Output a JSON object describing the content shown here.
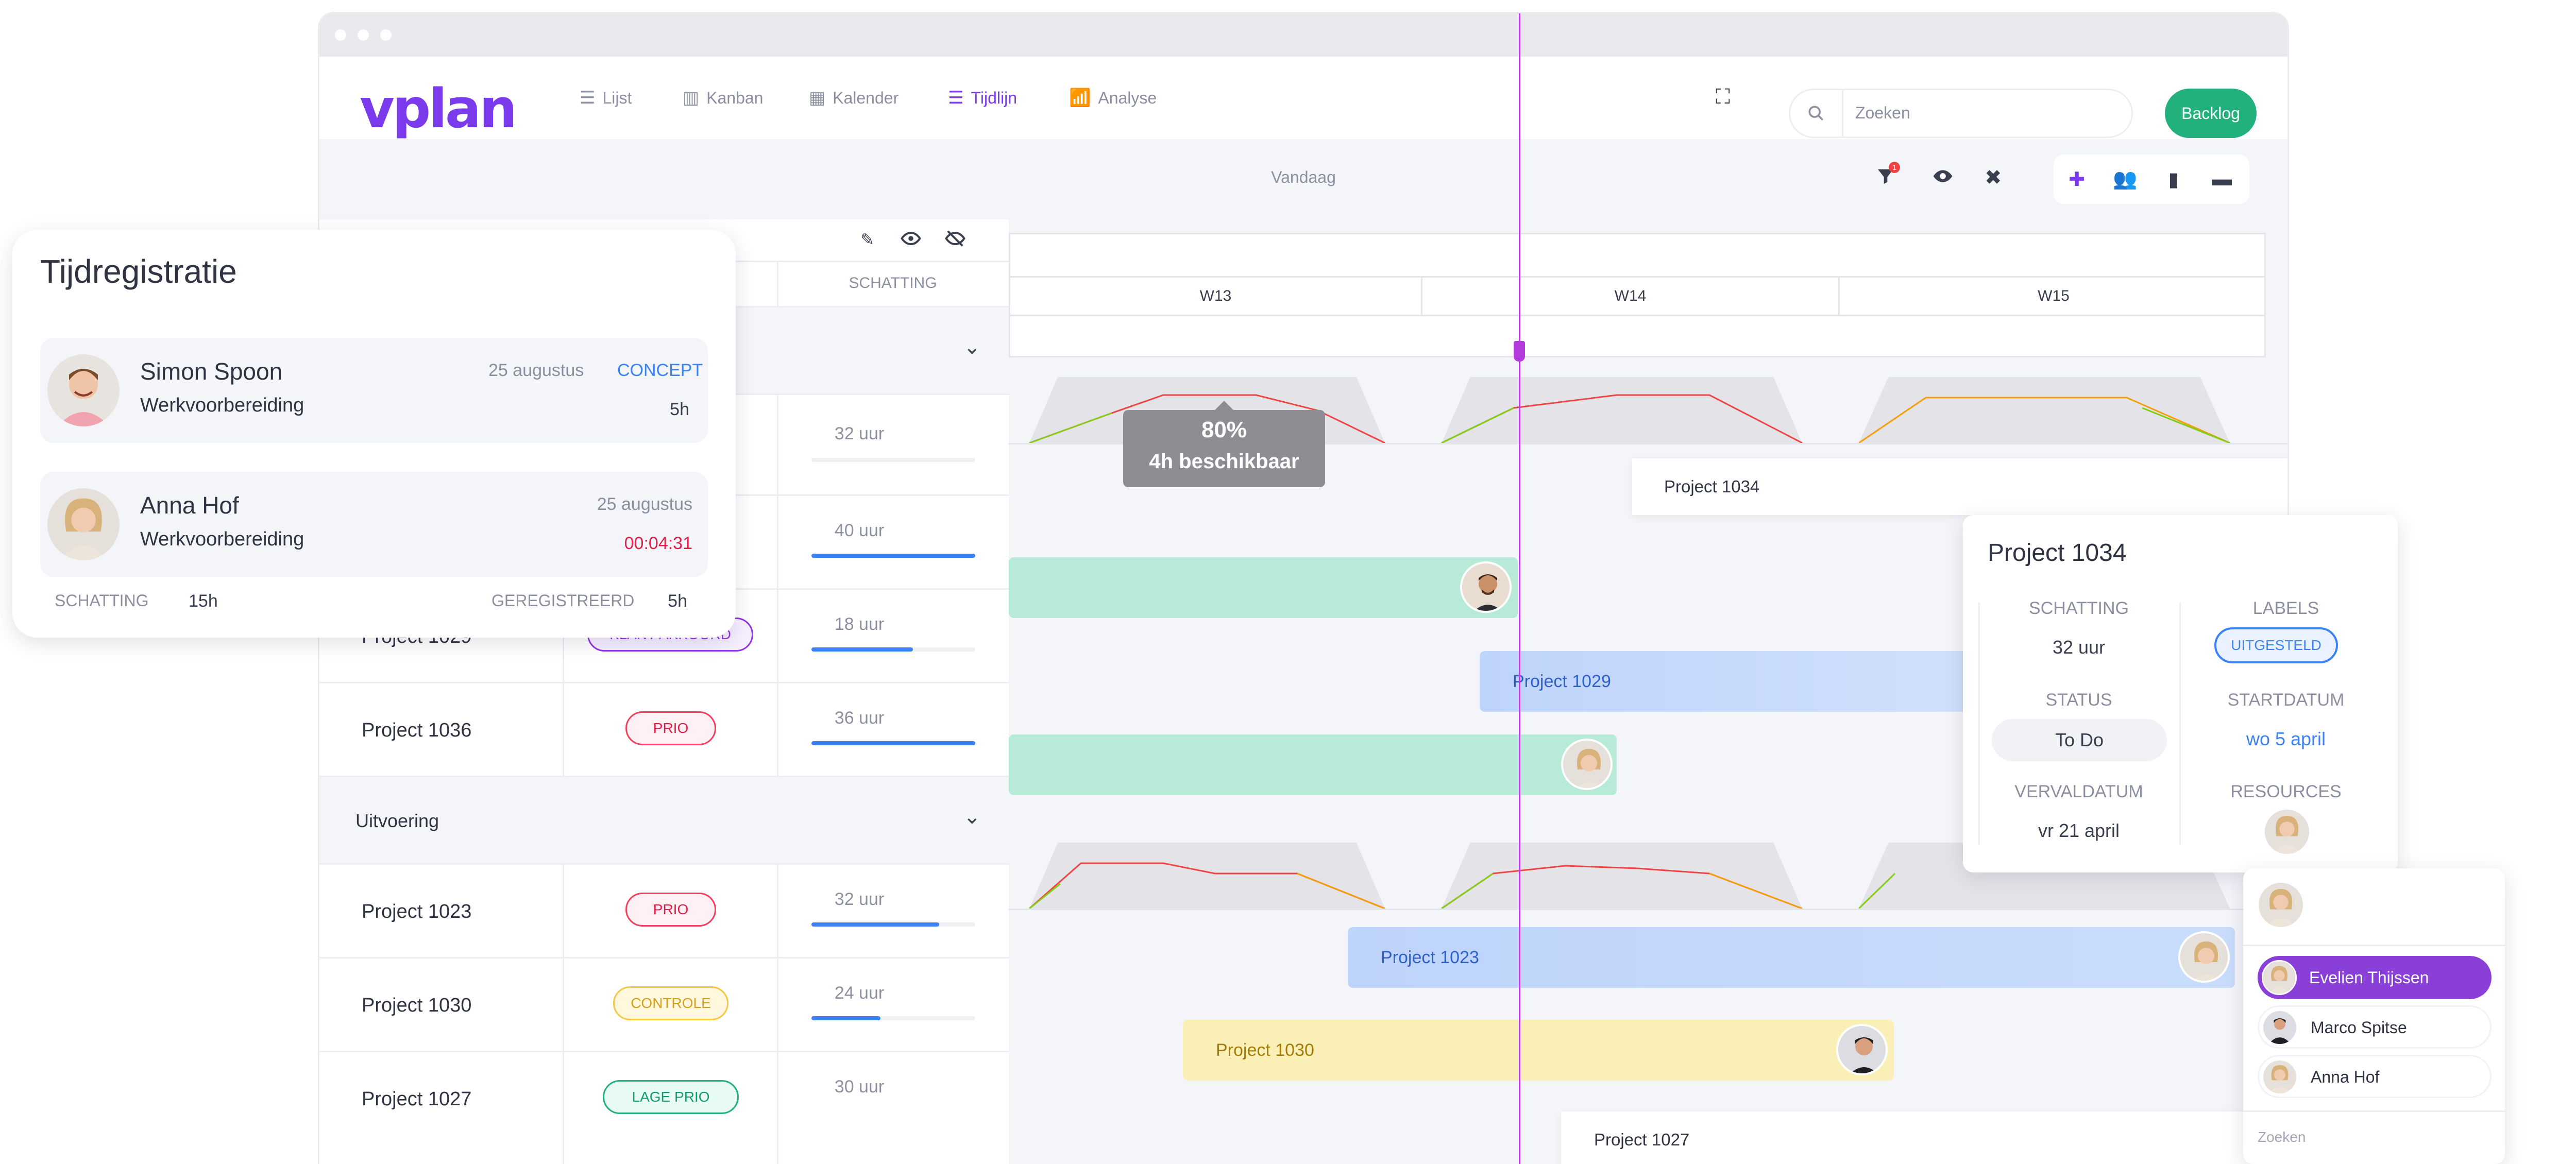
{
  "app": {
    "logo": "vplan",
    "nav": [
      {
        "label": "Lijst",
        "icon": "list-icon"
      },
      {
        "label": "Kanban",
        "icon": "kanban-icon"
      },
      {
        "label": "Kalender",
        "icon": "calendar-icon"
      },
      {
        "label": "Tijdlijn",
        "icon": "timeline-icon",
        "active": true
      },
      {
        "label": "Analyse",
        "icon": "chart-icon"
      }
    ],
    "search_placeholder": "Zoeken",
    "backlog_label": "Backlog",
    "today_label": "Vandaag",
    "filter_badge": "1"
  },
  "table": {
    "estimate_header": "SCHATTING",
    "rows_top": [
      {
        "estimate": "32 uur",
        "progress": 0.0
      },
      {
        "estimate": "40 uur",
        "progress": 1.0
      },
      {
        "name": "Project 1029",
        "tag": "KLANT AKKOORD",
        "estimate": "18 uur",
        "progress": 0.62
      },
      {
        "name": "Project 1036",
        "tag": "PRIO",
        "estimate": "36 uur",
        "progress": 1.0
      }
    ],
    "group2": "Uitvoering",
    "rows_bottom": [
      {
        "name": "Project 1023",
        "tag": "PRIO",
        "estimate": "32 uur",
        "progress": 0.78
      },
      {
        "name": "Project 1030",
        "tag": "CONTROLE",
        "estimate": "24 uur",
        "progress": 0.42
      },
      {
        "name": "Project 1027",
        "tag": "LAGE PRIO",
        "estimate": "30 uur",
        "progress": 0.0
      }
    ]
  },
  "timeline": {
    "weeks": [
      "W13",
      "W14",
      "W15"
    ],
    "tooltip": {
      "percent": "80%",
      "available": "4h beschikbaar"
    },
    "bars": {
      "p1034": "Project 1034",
      "p1029": "Project 1029",
      "p1023": "Project 1023",
      "p1030": "Project 1030",
      "p1027": "Project 1027"
    }
  },
  "time_registration": {
    "title": "Tijdregistratie",
    "entries": [
      {
        "name": "Simon Spoon",
        "date": "25 augustus",
        "status": "CONCEPT",
        "task": "Werkvoorbereiding",
        "duration": "5h"
      },
      {
        "name": "Anna Hof",
        "date": "25 augustus",
        "task": "Werkvoorbereiding",
        "duration": "00:04:31"
      }
    ],
    "footer": {
      "estimate_label": "SCHATTING",
      "estimate_value": "15h",
      "registered_label": "GEREGISTREERD",
      "registered_value": "5h"
    }
  },
  "detail": {
    "title": "Project 1034",
    "estimate_label": "SCHATTING",
    "estimate_value": "32 uur",
    "labels_label": "LABELS",
    "labels_value": "UITGESTELD",
    "status_label": "STATUS",
    "status_value": "To Do",
    "start_label": "STARTDATUM",
    "start_value": "wo 5 april",
    "due_label": "VERVALDATUM",
    "due_value": "vr 21 april",
    "resources_label": "RESOURCES"
  },
  "resources": {
    "people": [
      "Evelien Thijssen",
      "Marco Spitse",
      "Anna Hof"
    ],
    "search_placeholder": "Zoeken"
  },
  "colors": {
    "brand": "#7c3aed",
    "green": "#22b07d",
    "blue_bar": "#c7d9fb",
    "green_bar": "#b8ead8",
    "yellow_bar": "#fbefb8",
    "today_line": "#b23cdc"
  }
}
